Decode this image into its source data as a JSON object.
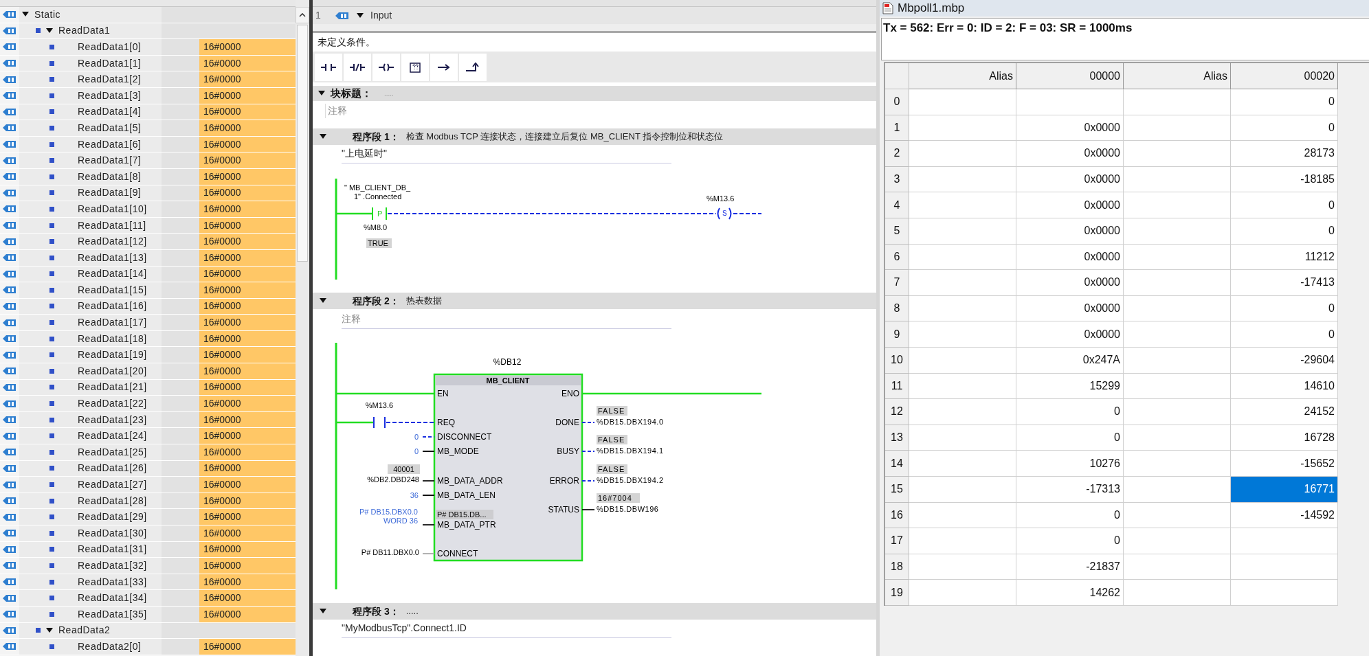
{
  "variables_panel": {
    "tree": [
      {
        "name": "Static",
        "expanded": true,
        "children": [
          {
            "name": "ReadData1",
            "expanded": true,
            "children": [
              {
                "name": "ReadData1[0]",
                "value": "16#0000"
              },
              {
                "name": "ReadData1[1]",
                "value": "16#0000"
              },
              {
                "name": "ReadData1[2]",
                "value": "16#0000"
              },
              {
                "name": "ReadData1[3]",
                "value": "16#0000"
              },
              {
                "name": "ReadData1[4]",
                "value": "16#0000"
              },
              {
                "name": "ReadData1[5]",
                "value": "16#0000"
              },
              {
                "name": "ReadData1[6]",
                "value": "16#0000"
              },
              {
                "name": "ReadData1[7]",
                "value": "16#0000"
              },
              {
                "name": "ReadData1[8]",
                "value": "16#0000"
              },
              {
                "name": "ReadData1[9]",
                "value": "16#0000"
              },
              {
                "name": "ReadData1[10]",
                "value": "16#0000"
              },
              {
                "name": "ReadData1[11]",
                "value": "16#0000"
              },
              {
                "name": "ReadData1[12]",
                "value": "16#0000"
              },
              {
                "name": "ReadData1[13]",
                "value": "16#0000"
              },
              {
                "name": "ReadData1[14]",
                "value": "16#0000"
              },
              {
                "name": "ReadData1[15]",
                "value": "16#0000"
              },
              {
                "name": "ReadData1[16]",
                "value": "16#0000"
              },
              {
                "name": "ReadData1[17]",
                "value": "16#0000"
              },
              {
                "name": "ReadData1[18]",
                "value": "16#0000"
              },
              {
                "name": "ReadData1[19]",
                "value": "16#0000"
              },
              {
                "name": "ReadData1[20]",
                "value": "16#0000"
              },
              {
                "name": "ReadData1[21]",
                "value": "16#0000"
              },
              {
                "name": "ReadData1[22]",
                "value": "16#0000"
              },
              {
                "name": "ReadData1[23]",
                "value": "16#0000"
              },
              {
                "name": "ReadData1[24]",
                "value": "16#0000"
              },
              {
                "name": "ReadData1[25]",
                "value": "16#0000"
              },
              {
                "name": "ReadData1[26]",
                "value": "16#0000"
              },
              {
                "name": "ReadData1[27]",
                "value": "16#0000"
              },
              {
                "name": "ReadData1[28]",
                "value": "16#0000"
              },
              {
                "name": "ReadData1[29]",
                "value": "16#0000"
              },
              {
                "name": "ReadData1[30]",
                "value": "16#0000"
              },
              {
                "name": "ReadData1[31]",
                "value": "16#0000"
              },
              {
                "name": "ReadData1[32]",
                "value": "16#0000"
              },
              {
                "name": "ReadData1[33]",
                "value": "16#0000"
              },
              {
                "name": "ReadData1[34]",
                "value": "16#0000"
              },
              {
                "name": "ReadData1[35]",
                "value": "16#0000"
              }
            ]
          },
          {
            "name": "ReadData2",
            "expanded": true,
            "children": [
              {
                "name": "ReadData2[0]",
                "value": "16#0000"
              }
            ]
          }
        ]
      }
    ]
  },
  "interface_table": {
    "rows": [
      {
        "number": "1",
        "name": "Input",
        "expanded": true
      }
    ]
  },
  "editor": {
    "condition_text": "未定义条件。",
    "block_title": {
      "label": "块标题：",
      "placeholder": ".....",
      "expanded": true
    },
    "block_comment": "注释",
    "networks": [
      {
        "title": "程序段 1：",
        "expanded": true,
        "comment": "检查 Modbus TCP 连接状态，连接建立后复位 MB_CLIENT 指令控制位和状态位",
        "note": "\"上电延时\"",
        "ladder": {
          "contact_lines": [
            "\" MB_CLIENT_DB_",
            "1\" .Connected"
          ],
          "contact_type": "P",
          "contact_address": "%M8.0",
          "contact_monitor": "TRUE",
          "coil_type": "S",
          "coil_address": "%M13.6",
          "output_powered": false
        }
      },
      {
        "title": "程序段 2：",
        "expanded": true,
        "comment": "热表数据",
        "note": "注释",
        "block": {
          "instance": "%DB12",
          "name": "MB_CLIENT",
          "powered": true,
          "inputs": [
            {
              "pin": "EN",
              "kind": "power"
            },
            {
              "pin": "REQ",
              "kind": "contact",
              "operand": "%M13.6"
            },
            {
              "pin": "DISCONNECT",
              "kind": "constant",
              "operand": "0",
              "dashed": true
            },
            {
              "pin": "MB_MODE",
              "kind": "constant",
              "operand": "0",
              "dashed": false
            },
            {
              "pin": "MB_DATA_ADDR",
              "kind": "address",
              "operand": "%DB2.DBD248",
              "monitor": "40001"
            },
            {
              "pin": "MB_DATA_LEN",
              "kind": "constant",
              "operand": "36",
              "dashed": false
            },
            {
              "pin": "MB_DATA_PTR",
              "kind": "pointer",
              "operand_lines": [
                "P# DB15.DBX0.0",
                "WORD 36"
              ],
              "monitor": "P# DB15.DB..."
            },
            {
              "pin": "CONNECT",
              "kind": "parameter",
              "operand": "P# DB11.DBX0.0"
            }
          ],
          "outputs": [
            {
              "pin": "ENO",
              "kind": "power"
            },
            {
              "pin": "DONE",
              "kind": "bit",
              "operand": "%DB15.DBX194.0",
              "monitor": "FALSE"
            },
            {
              "pin": "BUSY",
              "kind": "bit",
              "operand": "%DB15.DBX194.1",
              "monitor": "FALSE"
            },
            {
              "pin": "ERROR",
              "kind": "bit",
              "operand": "%DB15.DBX194.2",
              "monitor": "FALSE"
            },
            {
              "pin": "STATUS",
              "kind": "word",
              "operand": "%DB15.DBW196",
              "monitor": "16#7004"
            }
          ]
        }
      },
      {
        "title": "程序段 3：",
        "expanded": true,
        "comment": ".....",
        "note": "\"MyModbusTcp\".Connect1.ID"
      }
    ]
  },
  "mbpoll": {
    "title": "Mbpoll1.mbp",
    "status": "Tx = 562: Err = 0: ID = 2: F = 03: SR = 1000ms",
    "columns": [
      "Alias",
      "00000",
      "Alias",
      "00020"
    ],
    "rows": [
      {
        "index": "0",
        "value_2": "0",
        "selected": false
      },
      {
        "index": "1",
        "value_1": "0x0000",
        "value_2": "0",
        "selected": false
      },
      {
        "index": "2",
        "value_1": "0x0000",
        "value_2": "28173",
        "selected": false
      },
      {
        "index": "3",
        "value_1": "0x0000",
        "value_2": "-18185",
        "selected": false
      },
      {
        "index": "4",
        "value_1": "0x0000",
        "value_2": "0",
        "selected": false
      },
      {
        "index": "5",
        "value_1": "0x0000",
        "value_2": "0",
        "selected": false
      },
      {
        "index": "6",
        "value_1": "0x0000",
        "value_2": "11212",
        "selected": false
      },
      {
        "index": "7",
        "value_1": "0x0000",
        "value_2": "-17413",
        "selected": false
      },
      {
        "index": "8",
        "value_1": "0x0000",
        "value_2": "0",
        "selected": false
      },
      {
        "index": "9",
        "value_1": "0x0000",
        "value_2": "0",
        "selected": false
      },
      {
        "index": "10",
        "value_1": "0x247A",
        "value_2": "-29604",
        "selected": false
      },
      {
        "index": "11",
        "value_1": "15299",
        "value_2": "14610",
        "selected": false
      },
      {
        "index": "12",
        "value_1": "0",
        "value_2": "24152",
        "selected": false
      },
      {
        "index": "13",
        "value_1": "0",
        "value_2": "16728",
        "selected": false
      },
      {
        "index": "14",
        "value_1": "10276",
        "value_2": "-15652",
        "selected": false
      },
      {
        "index": "15",
        "value_1": "-17313",
        "value_2": "16771",
        "selected": true
      },
      {
        "index": "16",
        "value_1": "0",
        "value_2": "-14592",
        "selected": false
      },
      {
        "index": "17",
        "value_1": "0",
        "selected": false
      },
      {
        "index": "18",
        "value_1": "-21837",
        "selected": false
      },
      {
        "index": "19",
        "value_1": "14262",
        "selected": false
      }
    ]
  }
}
